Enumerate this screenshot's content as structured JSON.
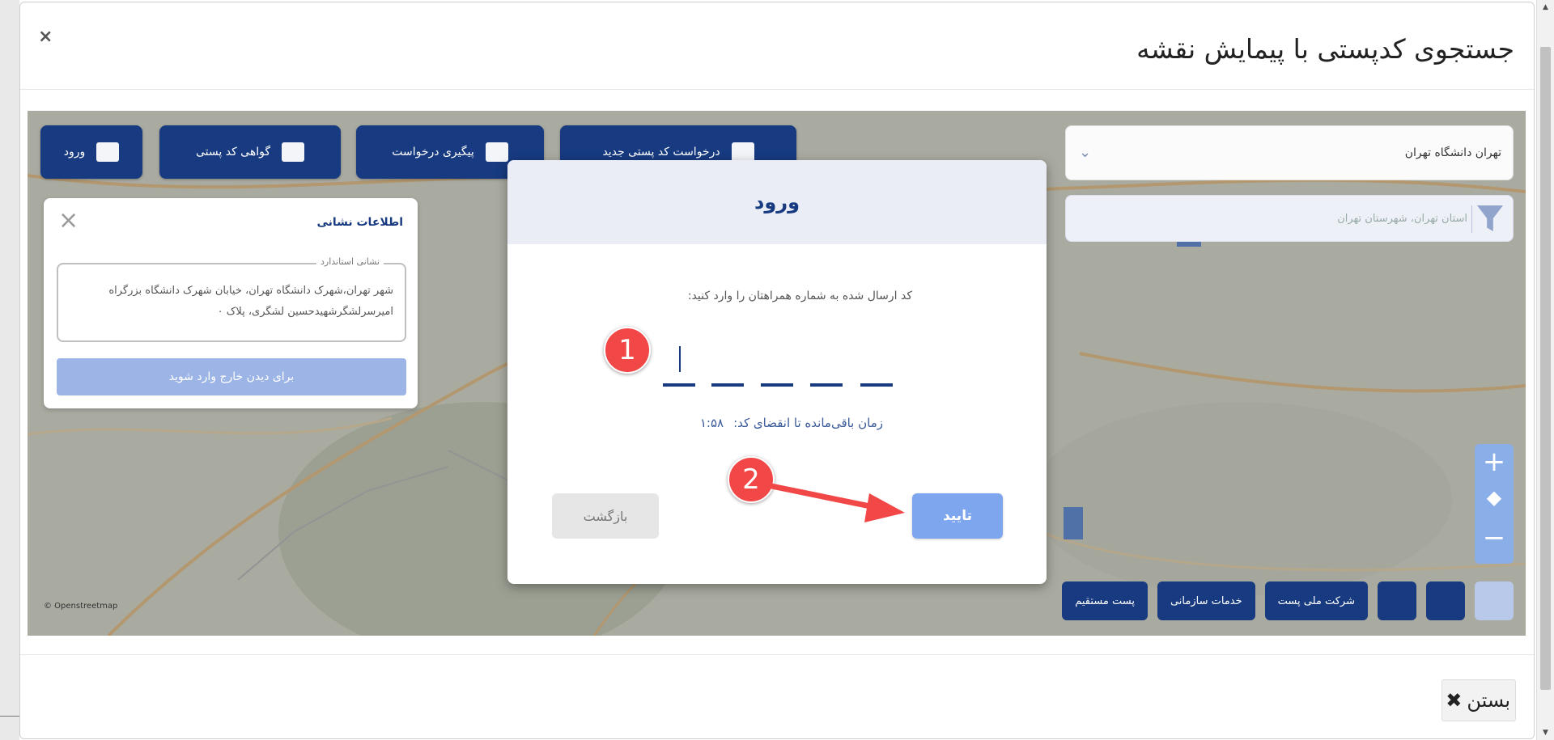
{
  "modal": {
    "title": "جستجوی کدپستی با پیمایش نقشه",
    "close_x": "×",
    "close_button_label": "بستن",
    "close_button_x": "✖"
  },
  "map": {
    "buttons": [
      {
        "label": "ورود",
        "icon": "unlock-icon"
      },
      {
        "label": "گواهی کد پستی",
        "icon": "certificate-icon"
      },
      {
        "label": "پیگیری درخواست",
        "icon": "tracking-icon"
      },
      {
        "label": "درخواست کد پستی جدید",
        "icon": "new-request-icon"
      }
    ],
    "search_value": "تهران دانشگاه تهران",
    "filter_text": "استان تهران، شهرستان تهران",
    "info_panel": {
      "title": "اطلاعات نشانی",
      "legend": "نشانی استاندارد",
      "address": "شهر تهران،شهرک دانشگاه تهران، خیابان شهرک دانشگاه بزرگراه امیرسرلشگرشهیدحسین لشگری، پلاک ۰",
      "login_hint": "برای دیدن خارج وارد شوید"
    },
    "bottom_buttons": [
      "شرکت ملی پست",
      "خدمات سازمانی",
      "پست مستقیم"
    ],
    "attribution": "© Openstreetmap"
  },
  "login": {
    "title": "ورود",
    "prompt": "کد ارسال شده به شماره همراهتان را وارد کنید:",
    "otp_value": "",
    "timer_label": "زمان باقی‌مانده تا انقضای کد:",
    "timer_value": "۱:۵۸",
    "confirm_label": "تایید",
    "back_label": "بازگشت"
  },
  "annotations": {
    "step1": "1",
    "step2": "2"
  },
  "colors": {
    "brand": "#173a80",
    "confirm": "#7ea6ef",
    "marker": "#f24747"
  }
}
